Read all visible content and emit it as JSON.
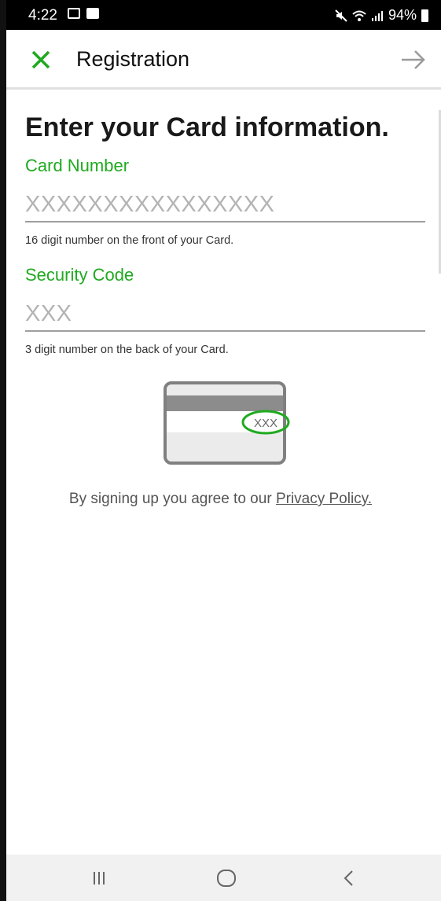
{
  "status_bar": {
    "time": "4:22",
    "battery": "94%"
  },
  "app_bar": {
    "title": "Registration",
    "close_icon": "close-icon",
    "next_icon": "arrow-right-icon",
    "accent_color": "#1faa1f"
  },
  "form": {
    "heading": "Enter your Card information.",
    "card_number": {
      "label": "Card Number",
      "placeholder": "XXXXXXXXXXXXXXXX",
      "hint": "16 digit number on the front of your Card."
    },
    "security_code": {
      "label": "Security Code",
      "placeholder": "XXX",
      "hint": "3 digit number on the back of your Card."
    }
  },
  "card_illustration": {
    "code_text": "XXX"
  },
  "agreement": {
    "text": "By signing up you agree to our",
    "link_text": "Privacy Policy."
  },
  "nav_bar": {
    "recents_icon": "recents-icon",
    "home_icon": "home-icon",
    "back_icon": "back-icon"
  }
}
